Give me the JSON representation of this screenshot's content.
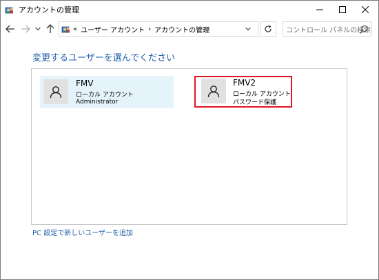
{
  "window": {
    "title": "アカウントの管理",
    "icon": "control-panel-icon"
  },
  "navigation": {
    "address": {
      "prefix": "«",
      "crumbs": [
        "ユーザー アカウント",
        "アカウントの管理"
      ],
      "separator": "›"
    },
    "search_placeholder": "コントロール パネルの検索"
  },
  "main": {
    "heading": "変更するユーザーを選んでください",
    "accounts": [
      {
        "name": "FMV",
        "type": "ローカル アカウント",
        "detail": "Administrator",
        "selected": false
      },
      {
        "name": "FMV2",
        "type": "ローカル アカウント",
        "detail": "パスワード保護",
        "highlighted": true
      }
    ],
    "add_user_link": "PC 設定で新しいユーザーを追加"
  },
  "colors": {
    "link": "#1e5dab",
    "tile_hover": "#e5f3fb",
    "highlight_border": "#e3141e",
    "avatar_bg": "#e1e1e1"
  }
}
